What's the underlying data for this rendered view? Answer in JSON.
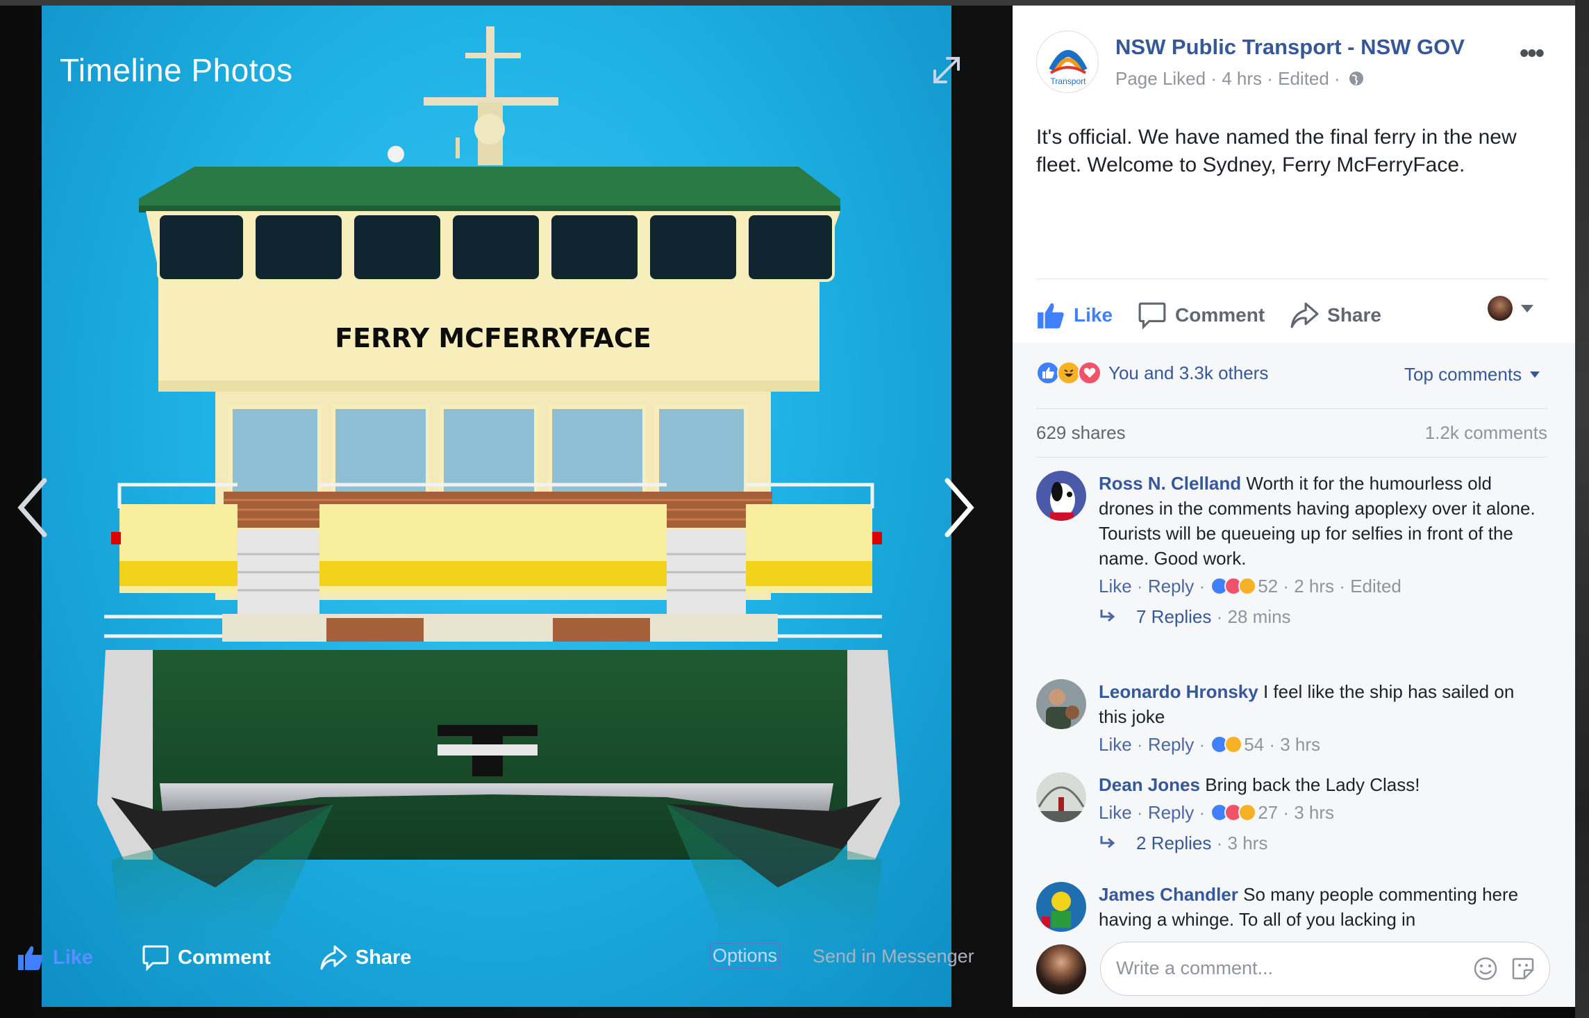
{
  "viewer": {
    "title": "Timeline Photos",
    "boat_name": "FERRY MCFERRYFACE",
    "actions": {
      "like": "Like",
      "comment": "Comment",
      "share": "Share",
      "options": "Options",
      "send_messenger": "Send in Messenger"
    }
  },
  "post": {
    "page_name": "NSW Public Transport - NSW GOV",
    "page_logo_text": "Transport",
    "meta": "Page Liked · 4 hrs · Edited ·",
    "text": "It's official. We have named the final ferry in the new fleet. Welcome to Sydney, Ferry McFerryFace.",
    "actions": {
      "like": "Like",
      "comment": "Comment",
      "share": "Share"
    },
    "reactions_text": "You and 3.3k others",
    "top_comments": "Top comments",
    "shares": "629 shares",
    "comments_count": "1.2k comments"
  },
  "comments": [
    {
      "name": "Ross N. Clelland",
      "text": "Worth it for the humourless old drones in the comments having apoplexy over it alone.",
      "text2": "Tourists will be queueing up for selfies in front of the name. Good work.",
      "like": "Like",
      "reply": "Reply",
      "count": "52",
      "time": "2 hrs",
      "edited": "Edited",
      "replies": "7 Replies",
      "replies_time": "28 mins"
    },
    {
      "name": "Leonardo Hronsky",
      "text": "I feel like the ship has sailed on this joke",
      "like": "Like",
      "reply": "Reply",
      "count": "54",
      "time": "3 hrs"
    },
    {
      "name": "Dean Jones",
      "text": "Bring back the Lady Class!",
      "like": "Like",
      "reply": "Reply",
      "count": "27",
      "time": "3 hrs",
      "replies": "2 Replies",
      "replies_time": "3 hrs"
    },
    {
      "name": "James Chandler",
      "text": "So many people commenting here having a whinge. To all of you lacking in"
    }
  ],
  "composer": {
    "placeholder": "Write a comment..."
  },
  "colors": {
    "link": "#365899",
    "like_blue": "#4080ff",
    "photo_bg": "#1fb2e6",
    "hull_green": "#1e5a32"
  }
}
